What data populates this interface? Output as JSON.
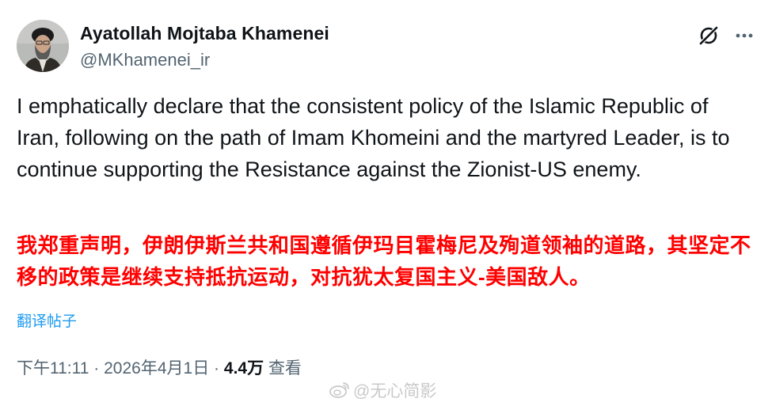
{
  "author": {
    "name": "Ayatollah Mojtaba Khamenei",
    "handle": "@MKhamenei_ir"
  },
  "tweet": {
    "text_en": "I emphatically declare that the consistent policy of the Islamic Republic of Iran, following on the path of Imam Khomeini and the martyred Leader, is to continue supporting the Resistance against the Zionist-US enemy.",
    "text_zh": "我郑重声明，伊朗伊斯兰共和国遵循伊玛目霍梅尼及殉道领袖的道路，其坚定不移的政策是继续支持抵抗运动，对抗犹太复国主义-美国敌人。",
    "translate_label": "翻译帖子"
  },
  "meta": {
    "time": "下午11:11",
    "separator": "·",
    "date": "2026年4月1日",
    "views_count": "4.4万",
    "views_label": "查看"
  },
  "watermark": {
    "text": "@无心简影"
  },
  "icons": {
    "grok": "grok-icon",
    "more": "more-dots-icon",
    "watermark_logo": "weibo-icon"
  },
  "colors": {
    "text_primary": "#0f1419",
    "text_secondary": "#536471",
    "link": "#1d9bf0",
    "highlight_red": "#ff0000"
  }
}
